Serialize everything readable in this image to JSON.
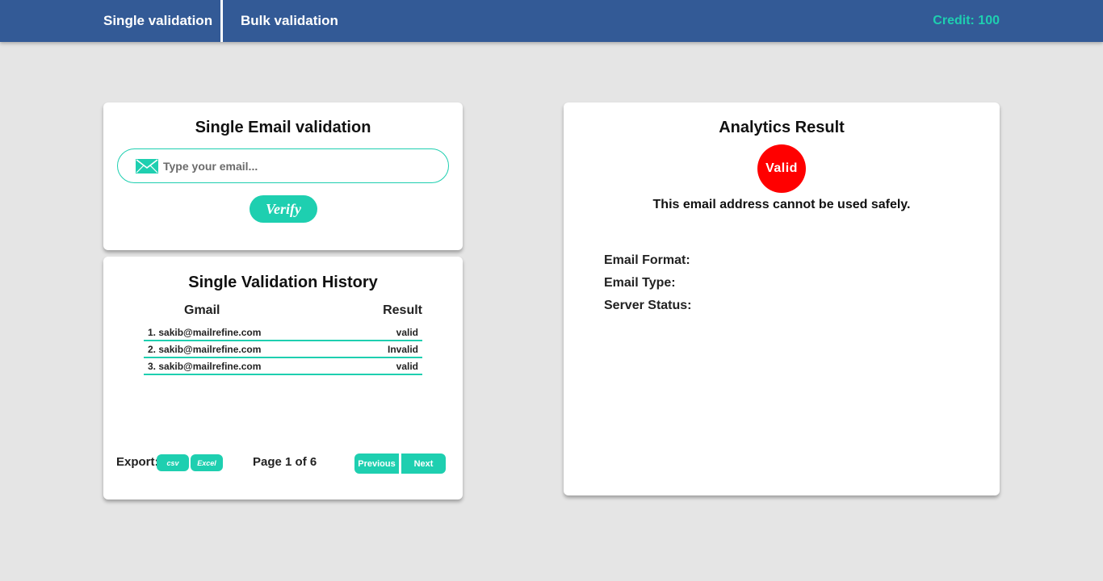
{
  "navbar": {
    "tabs": [
      {
        "label": "Single validation"
      },
      {
        "label": "Bulk validation"
      }
    ],
    "credit": "Credit: 100"
  },
  "single": {
    "title": "Single Email validation",
    "input_placeholder": "Type your email...",
    "input_value": "",
    "verify_label": "Verify",
    "icon": "mail-icon"
  },
  "history": {
    "title": "Single Validation History",
    "columns": {
      "gmail": "Gmail",
      "result": "Result"
    },
    "rows": [
      {
        "email": "1. sakib@mailrefine.com",
        "result": "valid"
      },
      {
        "email": "2. sakib@mailrefine.com",
        "result": "Invalid"
      },
      {
        "email": "3. sakib@mailrefine.com",
        "result": "valid"
      }
    ],
    "export_label": "Export:",
    "csv_label": "csv",
    "excel_label": "Excel",
    "page_info": "Page 1 of 6",
    "previous_label": "Previous",
    "next_label": "Next"
  },
  "analytics": {
    "title": "Analytics Result",
    "status_badge": "Valid",
    "status_color": "#ff0000",
    "message": "This email address cannot be used safely.",
    "details": [
      {
        "label": "Email Format:"
      },
      {
        "label": "Email Type:"
      },
      {
        "label": "Server Status:"
      }
    ]
  },
  "colors": {
    "navbar": "#335a96",
    "accent": "#1ecfb0",
    "background": "#e5e5e5"
  }
}
